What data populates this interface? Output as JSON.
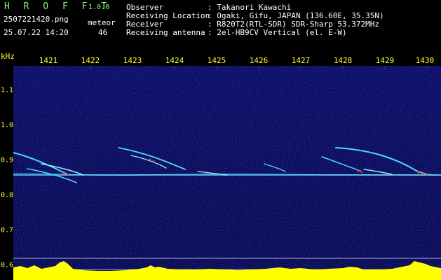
{
  "header": {
    "brand": "H R O F F T",
    "version": "1.0.0",
    "filename": "2507221420.png",
    "mode_label": "meteor",
    "datetime": "25.07.22 14:20",
    "count": "46",
    "observer_label": "Observer",
    "observer_value": ": Takanori Kawachi",
    "location_label": "Receiving Location",
    "location_value": ": Ogaki, Gifu, JAPAN (136.60E, 35.35N)",
    "receiver_label": "Receiver",
    "receiver_value": ": R820T2(RTL-SDR) SDR-Sharp 53.372MHz",
    "antenna_label": "Receiving antenna",
    "antenna_value": ": 2el-HB9CV Vertical (el. E-W)"
  },
  "axes": {
    "y_unit": "kHz",
    "x_ticks": [
      "1421",
      "1422",
      "1423",
      "1424",
      "1425",
      "1426",
      "1427",
      "1428",
      "1429",
      "1430"
    ],
    "y_ticks": [
      "1.1",
      "1.0",
      "0.9",
      "0.8",
      "0.7",
      "0.6"
    ]
  },
  "colors": {
    "header_green": "#7dff6a",
    "axis_yellow": "#ffff33",
    "spectrogram_bg": "#06063a",
    "signal_cyan": "#4ad8ff",
    "signal_red": "#ff3a3a",
    "level_yellow": "#ffff00",
    "level_cyan": "#33ffff"
  },
  "icons": [
    "spectrogram-display"
  ]
}
